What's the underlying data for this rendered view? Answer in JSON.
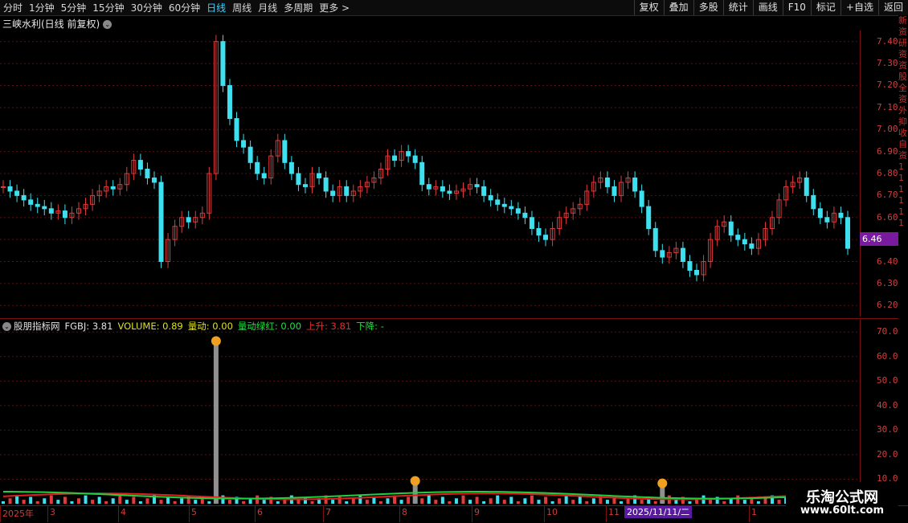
{
  "toolbar": {
    "periods": [
      {
        "label": "分时",
        "active": false
      },
      {
        "label": "1分钟",
        "active": false
      },
      {
        "label": "5分钟",
        "active": false
      },
      {
        "label": "15分钟",
        "active": false
      },
      {
        "label": "30分钟",
        "active": false
      },
      {
        "label": "60分钟",
        "active": false
      },
      {
        "label": "日线",
        "active": true
      },
      {
        "label": "周线",
        "active": false
      },
      {
        "label": "月线",
        "active": false
      },
      {
        "label": "多周期",
        "active": false
      },
      {
        "label": "更多 >",
        "active": false
      }
    ],
    "tools": [
      "复权",
      "叠加",
      "多股",
      "统计",
      "画线",
      "F10",
      "标记",
      "+自选",
      "返回"
    ]
  },
  "stock": {
    "title": "三峡水利(日线 前复权)"
  },
  "price_axis": {
    "ticks": [
      "7.40",
      "7.30",
      "7.20",
      "7.10",
      "7.00",
      "6.90",
      "6.80",
      "6.70",
      "6.60",
      "6.50",
      "6.40",
      "6.30",
      "6.20"
    ],
    "last_price": "6.46"
  },
  "indicator": {
    "name": "股朋指标网",
    "fgbj": "FGBJ: 3.81",
    "volume": "VOLUME: 0.89",
    "liangdong": "量动: 0.00",
    "liangdong_lvhong": "量动绿红: 0.00",
    "shangsheng": "上升: 3.81",
    "xiajiang": "下降: -",
    "ticks": [
      "70.00",
      "60.00",
      "50.00",
      "40.00",
      "30.00",
      "20.00",
      "10.00"
    ]
  },
  "date_axis": {
    "labels": [
      "2025年",
      "3",
      "4",
      "5",
      "6",
      "7",
      "8",
      "9",
      "10",
      "11",
      "1"
    ],
    "cursor_date": "2025/11/11/二"
  },
  "right_strip": [
    "新",
    "资",
    "研",
    "资",
    "资",
    "股",
    "全",
    "资",
    "外",
    "抑",
    "收",
    "自",
    "资",
    "1",
    "1",
    "1",
    "1",
    "1",
    "1"
  ],
  "watermark": {
    "title": "乐淘公式网",
    "url": "www.60lt.com"
  },
  "chart_data": {
    "type": "candlestick",
    "price_ylim": [
      6.15,
      7.45
    ],
    "indicator_ylim": [
      0,
      75
    ],
    "colors": {
      "up": "#e23b3b",
      "down": "#3ee0f0",
      "grid": "#5a1010",
      "ma_red": "#e02020",
      "ma_green": "#20d040"
    },
    "close_approx": [
      6.74,
      6.72,
      6.7,
      6.68,
      6.66,
      6.65,
      6.64,
      6.62,
      6.63,
      6.6,
      6.62,
      6.64,
      6.66,
      6.7,
      6.72,
      6.74,
      6.73,
      6.75,
      6.8,
      6.86,
      6.82,
      6.78,
      6.76,
      6.4,
      6.5,
      6.56,
      6.6,
      6.58,
      6.6,
      6.62,
      6.8,
      7.4,
      7.2,
      7.05,
      6.95,
      6.92,
      6.85,
      6.8,
      6.78,
      6.88,
      6.95,
      6.85,
      6.8,
      6.75,
      6.74,
      6.8,
      6.78,
      6.72,
      6.7,
      6.74,
      6.7,
      6.72,
      6.74,
      6.76,
      6.78,
      6.82,
      6.88,
      6.86,
      6.9,
      6.88,
      6.85,
      6.75,
      6.73,
      6.74,
      6.72,
      6.71,
      6.72,
      6.73,
      6.75,
      6.74,
      6.7,
      6.68,
      6.66,
      6.65,
      6.64,
      6.62,
      6.6,
      6.55,
      6.52,
      6.5,
      6.55,
      6.6,
      6.62,
      6.64,
      6.66,
      6.72,
      6.76,
      6.78,
      6.74,
      6.7,
      6.76,
      6.78,
      6.72,
      6.65,
      6.55,
      6.45,
      6.42,
      6.44,
      6.46,
      6.4,
      6.36,
      6.34,
      6.4,
      6.5,
      6.56,
      6.58,
      6.52,
      6.5,
      6.48,
      6.46,
      6.5,
      6.55,
      6.6,
      6.68,
      6.74,
      6.76,
      6.78,
      6.7,
      6.64,
      6.6,
      6.58,
      6.62,
      6.6,
      6.46
    ],
    "volume_spikes": [
      {
        "index": 31,
        "value": 65
      },
      {
        "index": 60,
        "value": 8
      },
      {
        "index": 96,
        "value": 7
      }
    ]
  }
}
